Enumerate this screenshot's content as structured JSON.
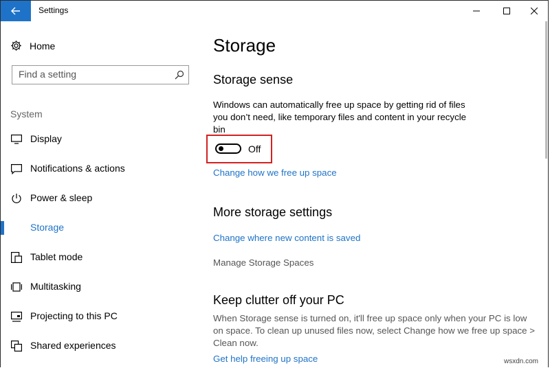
{
  "window": {
    "title": "Settings"
  },
  "sidebar": {
    "home_label": "Home",
    "search_placeholder": "Find a setting",
    "section_label": "System",
    "items": [
      {
        "label": "Display",
        "icon": "display-icon"
      },
      {
        "label": "Notifications & actions",
        "icon": "notifications-icon"
      },
      {
        "label": "Power & sleep",
        "icon": "power-icon"
      },
      {
        "label": "Storage",
        "icon": "storage-icon",
        "active": true
      },
      {
        "label": "Tablet mode",
        "icon": "tablet-mode-icon"
      },
      {
        "label": "Multitasking",
        "icon": "multitasking-icon"
      },
      {
        "label": "Projecting to this PC",
        "icon": "projecting-icon"
      },
      {
        "label": "Shared experiences",
        "icon": "shared-experiences-icon"
      }
    ]
  },
  "main": {
    "title": "Storage",
    "storage_sense": {
      "heading": "Storage sense",
      "description": "Windows can automatically free up space by getting rid of files you don’t need, like temporary files and content in your recycle bin",
      "toggle_state": "Off",
      "toggle_on": false,
      "link": "Change how we free up space"
    },
    "more_settings": {
      "heading": "More storage settings",
      "link": "Change where new content is saved",
      "disabled_item": "Manage Storage Spaces"
    },
    "clutter": {
      "heading": "Keep clutter off your PC",
      "description": "When Storage sense is turned on, it'll free up space only when your PC is low on space. To clean up unused files now, select Change how we free up space > Clean now.",
      "link": "Get help freeing up space"
    }
  },
  "colors": {
    "accent": "#1e73c8",
    "highlight_box": "#d32020"
  },
  "watermark": "wsxdn.com"
}
